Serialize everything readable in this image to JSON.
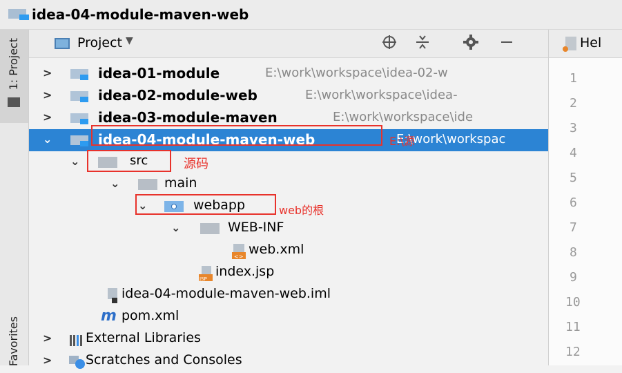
{
  "window": {
    "title": "idea-04-module-maven-web"
  },
  "sidebar": {
    "project_label": "1: Project",
    "favorites_label": "Favorites"
  },
  "panel": {
    "view_label": "Project",
    "view_caret": "▼"
  },
  "tree": [
    {
      "label": "idea-01-module",
      "path": "E:\\work\\workspace\\idea-02-w"
    },
    {
      "label": "idea-02-module-web",
      "path": "E:\\work\\workspace\\idea-"
    },
    {
      "label": "idea-03-module-maven",
      "path": "E:\\work\\workspace\\ide"
    },
    {
      "label": "idea-04-module-maven-web",
      "path": "E:\\work\\workspac"
    },
    {
      "label": "src"
    },
    {
      "label": "main"
    },
    {
      "label": "webapp"
    },
    {
      "label": "WEB-INF"
    },
    {
      "label": "web.xml"
    },
    {
      "label": "index.jsp"
    },
    {
      "label": "idea-04-module-maven-web.iml"
    },
    {
      "label": "pom.xml"
    },
    {
      "label": "External Libraries"
    },
    {
      "label": "Scratches and Consoles"
    }
  ],
  "annotations": {
    "src": "源码",
    "webapp": "web的根",
    "path_overlay": "E:\\源"
  },
  "editor": {
    "tab_label": "Hel",
    "line_numbers": [
      "1",
      "2",
      "3",
      "4",
      "5",
      "6",
      "7",
      "8",
      "9",
      "10",
      "11",
      "12"
    ]
  },
  "colors": {
    "selection": "#2c84d4",
    "annotation": "#e8322b"
  }
}
